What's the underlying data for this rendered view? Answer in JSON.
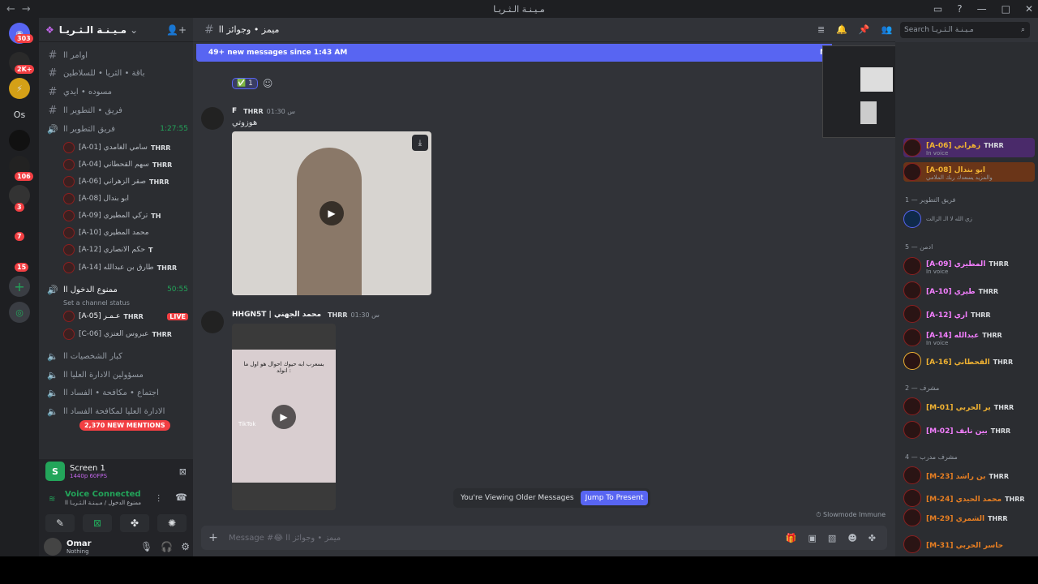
{
  "titlebar": {
    "title": "مـيـنـة الـثـريـا"
  },
  "guilds": [
    {
      "label": "303",
      "icon": "discord-icon"
    },
    {
      "label": "2K+",
      "icon": "server-icon"
    },
    {
      "label": "Os",
      "icon": "server-icon"
    },
    {
      "label": "106",
      "icon": "server-icon"
    },
    {
      "label": "3",
      "icon": "server-icon"
    },
    {
      "label": "7",
      "icon": "server-icon"
    },
    {
      "label": "15",
      "icon": "server-icon"
    }
  ],
  "server": {
    "name": "مـيـنـة الـثـريـا"
  },
  "channels": [
    {
      "label": "اوامر اا",
      "type": "text"
    },
    {
      "label": "باقة • الثريا • للسلاطين",
      "type": "text"
    },
    {
      "label": "مسوده • ايدي",
      "type": "text"
    },
    {
      "label": "فريق • التطوير اا",
      "type": "text"
    },
    {
      "label": "فريق التطوير اا",
      "type": "voice",
      "time": "1:27:55"
    }
  ],
  "voice_users": [
    {
      "name": "[A-01] سامي الغامدي",
      "tag": "THRR"
    },
    {
      "name": "[A-04] سهم القحطاني",
      "tag": "THRR"
    },
    {
      "name": "[A-06] صقر الزهراني",
      "tag": "THRR"
    },
    {
      "name": "[A-08] ابو بندال",
      "tag": ""
    },
    {
      "name": "[A-09] تركي المطيري",
      "tag": "TH"
    },
    {
      "name": "[A-10] محمد المطيري",
      "tag": ""
    },
    {
      "name": "[A-12] حكم الانصاري",
      "tag": "T"
    },
    {
      "name": "[A-14] طارق بن عبدالله",
      "tag": "THRR"
    }
  ],
  "channel2": {
    "label": "ممنوع الدخول اا",
    "time": "50:55",
    "status": "Set a channel status"
  },
  "voice_users2": [
    {
      "name": "[A-05] عـمـر",
      "tag": "THRR",
      "live": "LIVE"
    },
    {
      "name": "[C-06] عبروس العنزي",
      "tag": "THRR"
    }
  ],
  "channels3": [
    {
      "label": "كبار الشخصيات اا"
    },
    {
      "label": "مسؤولين الادارة العليا اا"
    },
    {
      "label": "اجتماع • مكافحة • الفساد اا"
    },
    {
      "label": "الادارة العليا لمكافحة الفساد اا"
    }
  ],
  "mentions": "2,370 NEW MENTIONS",
  "panel": {
    "screen_title": "Screen 1",
    "screen_sub": "1440p 60FPS",
    "voice_status": "Voice Connected",
    "voice_where": "ممنوع الدخول / مـيـنـة الـثـريـا اا",
    "user_name": "Omar",
    "user_status": "Nothing"
  },
  "chat": {
    "channel_name": "ميمز • وجوائز اا",
    "new_messages": "49+ new messages since 1:43 AM",
    "mark": "M",
    "search_placeholder": "Search مـيـنـة الـثـريـا",
    "reaction_count": "1",
    "msg1": {
      "author": "F",
      "tag": "THRR",
      "time": "س 01:30",
      "text": "هوزوتي"
    },
    "msg2": {
      "author": "HHGN5T | محمد الجهني",
      "tag": "THRR",
      "time": "س 01:30"
    },
    "video2_caption": "بسعرب ابه حيوك احوال هو اول ما انولد :",
    "video2_watermark": "TikTok",
    "older_text": "You're Viewing Older Messages",
    "jump_label": "Jump To Present",
    "slowmode": "Slowmode Immune",
    "composer_placeholder": "Message #😂 ميمز • وجوائز اا"
  },
  "members": {
    "groups": [
      {
        "label": "فريق التطوير — 1"
      },
      {
        "label": "ادمن — 5"
      },
      {
        "label": "مشرف — 2"
      },
      {
        "label": "مشرف مدرب — 4"
      }
    ],
    "list": [
      {
        "name": "[A-06] زهراني",
        "tag": "THRR",
        "sub": "In voice",
        "color": "#f0b232"
      },
      {
        "name": "[A-08] ابو بندال",
        "tag": "",
        "sub": "والمزيد يسعدك ربك الملامي",
        "color": "#f0b232"
      },
      {
        "name": "",
        "tag": "",
        "sub": "زي الله لا الـ الزالت",
        "color": "#5865f2"
      },
      {
        "name": "[A-09] المطيري",
        "tag": "THRR",
        "sub": "In voice",
        "color": "#f47fff"
      },
      {
        "name": "[A-10] طيري",
        "tag": "THRR",
        "sub": "",
        "color": "#f47fff"
      },
      {
        "name": "[A-12] اري",
        "tag": "THRR",
        "sub": "",
        "color": "#f47fff"
      },
      {
        "name": "[A-14] عبدالله",
        "tag": "THRR",
        "sub": "In voice",
        "color": "#f47fff"
      },
      {
        "name": "[A-16] القحطاني",
        "tag": "THRR",
        "sub": "",
        "color": "#f0b232"
      },
      {
        "name": "[M-01] ير الحربي",
        "tag": "THRR",
        "sub": "",
        "color": "#f0b232"
      },
      {
        "name": "[M-02] بين نايف",
        "tag": "THRR",
        "sub": "",
        "color": "#f47fff"
      },
      {
        "name": "[M-23] بن راشد",
        "tag": "THRR",
        "sub": "",
        "color": "#e67e22"
      },
      {
        "name": "[M-24] محمد الحيدي",
        "tag": "THRR",
        "sub": "",
        "color": "#e67e22"
      },
      {
        "name": "[M-29] الشمري",
        "tag": "THRR",
        "sub": "",
        "color": "#e67e22"
      },
      {
        "name": "[M-31] حاسر الحربي",
        "tag": "",
        "sub": "",
        "color": "#e67e22"
      }
    ]
  },
  "colors": {
    "accent": "#5865f2",
    "live": "#f23f43",
    "voice_green": "#23a55a"
  }
}
